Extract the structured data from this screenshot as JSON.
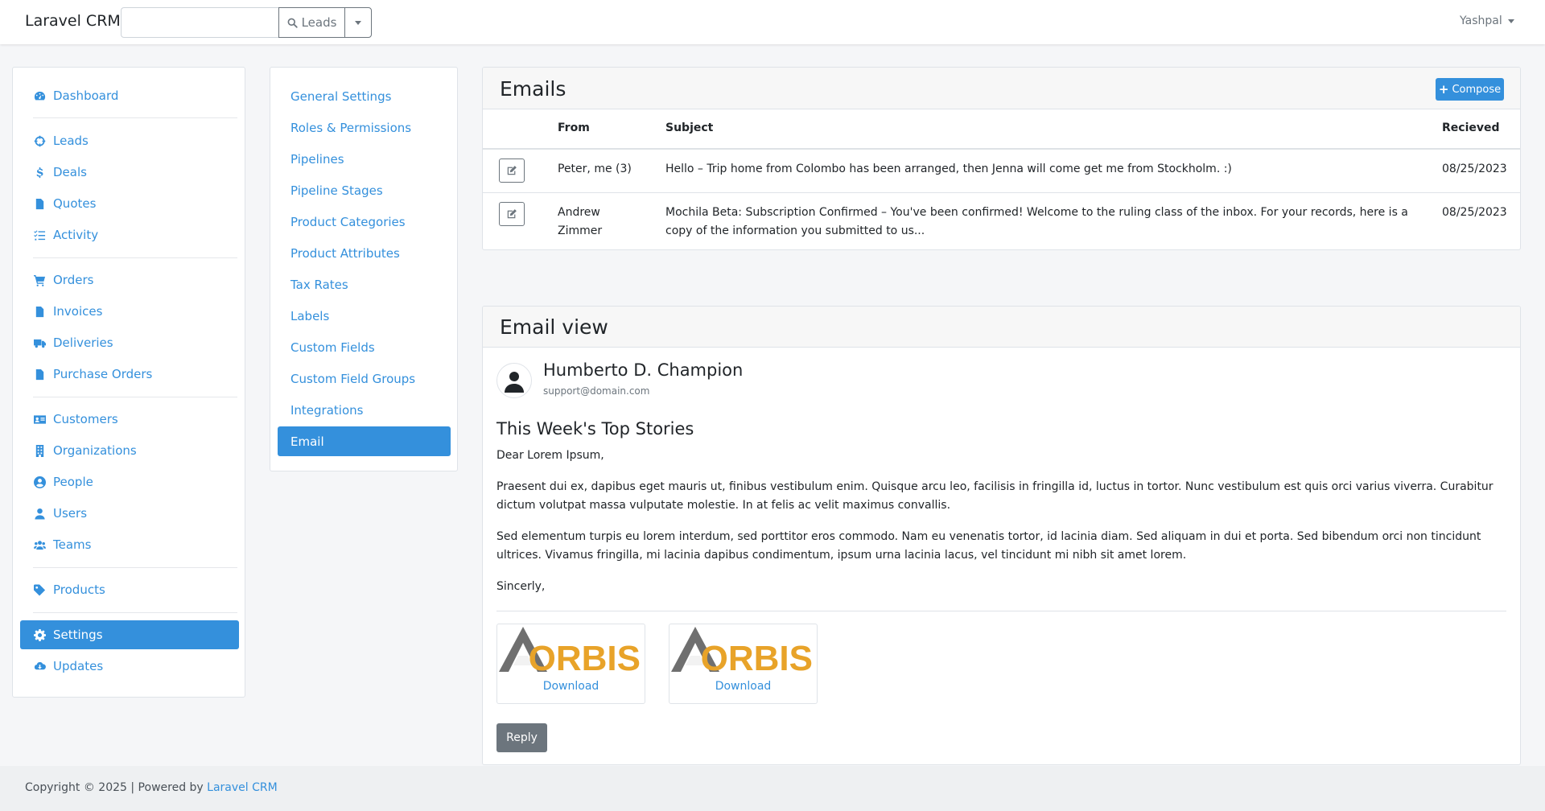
{
  "app": {
    "brand": "Laravel CRM",
    "user": "Yashpal"
  },
  "search": {
    "value": "",
    "placeholder": "",
    "button_label": "Leads"
  },
  "sidebar": {
    "items": [
      {
        "label": "Dashboard",
        "icon": "tachometer-icon"
      },
      {
        "label": "Leads",
        "icon": "crosshairs-icon"
      },
      {
        "label": "Deals",
        "icon": "dollar-icon"
      },
      {
        "label": "Quotes",
        "icon": "file-invoice-icon"
      },
      {
        "label": "Activity",
        "icon": "tasks-icon"
      },
      {
        "label": "Orders",
        "icon": "shopping-cart-icon"
      },
      {
        "label": "Invoices",
        "icon": "file-invoice-icon"
      },
      {
        "label": "Deliveries",
        "icon": "truck-icon"
      },
      {
        "label": "Purchase Orders",
        "icon": "file-invoice-icon"
      },
      {
        "label": "Customers",
        "icon": "address-card-icon"
      },
      {
        "label": "Organizations",
        "icon": "building-icon"
      },
      {
        "label": "People",
        "icon": "user-circle-icon"
      },
      {
        "label": "Users",
        "icon": "user-icon"
      },
      {
        "label": "Teams",
        "icon": "users-icon"
      },
      {
        "label": "Products",
        "icon": "tag-icon"
      },
      {
        "label": "Settings",
        "icon": "cog-icon",
        "active": true
      },
      {
        "label": "Updates",
        "icon": "cloud-download-icon"
      }
    ]
  },
  "settings_menu": {
    "items": [
      "General Settings",
      "Roles & Permissions",
      "Pipelines",
      "Pipeline Stages",
      "Product Categories",
      "Product Attributes",
      "Tax Rates",
      "Labels",
      "Custom Fields",
      "Custom Field Groups",
      "Integrations",
      "Email"
    ],
    "active": "Email"
  },
  "emails": {
    "title": "Emails",
    "compose_label": "Compose",
    "columns": {
      "from": "From",
      "subject": "Subject",
      "received": "Recieved"
    },
    "rows": [
      {
        "from": "Peter, me (3)",
        "subject": "Hello – Trip home from Colombo has been arranged, then Jenna will come get me from Stockholm. :)",
        "received": "08/25/2023"
      },
      {
        "from": "Andrew Zimmer",
        "subject": "Mochila Beta: Subscription Confirmed – You've been confirmed! Welcome to the ruling class of the inbox. For your records, here is a copy of the information you submitted to us...",
        "received": "08/25/2023"
      }
    ]
  },
  "email_view": {
    "title": "Email view",
    "sender_name": "Humberto D. Champion",
    "sender_email": "support@domain.com",
    "subject": "This Week's Top Stories",
    "greeting": "Dear Lorem Ipsum,",
    "paragraph1": "Praesent dui ex, dapibus eget mauris ut, finibus vestibulum enim. Quisque arcu leo, facilisis in fringilla id, luctus in tortor. Nunc vestibulum est quis orci varius viverra. Curabitur dictum volutpat massa vulputate molestie. In at felis ac velit maximus convallis.",
    "paragraph2": "Sed elementum turpis eu lorem interdum, sed porttitor eros commodo. Nam eu venenatis tortor, id lacinia diam. Sed aliquam in dui et porta. Sed bibendum orci non tincidunt ultrices. Vivamus fringilla, mi lacinia dapibus condimentum, ipsum urna lacinia lacus, vel tincidunt mi nibh sit amet lorem.",
    "closing": "Sincerly,",
    "attachments": [
      {
        "logo_text": "ORBIS",
        "link": "Download"
      },
      {
        "logo_text": "ORBIS",
        "link": "Download"
      }
    ],
    "reply_label": "Reply"
  },
  "footer": {
    "text": "Copyright © 2025 | Powered by",
    "link": "Laravel CRM"
  },
  "colors": {
    "primary": "#3490dc",
    "secondary": "#6c757d",
    "logo_orange": "#e8a329",
    "logo_gray": "#6f6f6f"
  }
}
